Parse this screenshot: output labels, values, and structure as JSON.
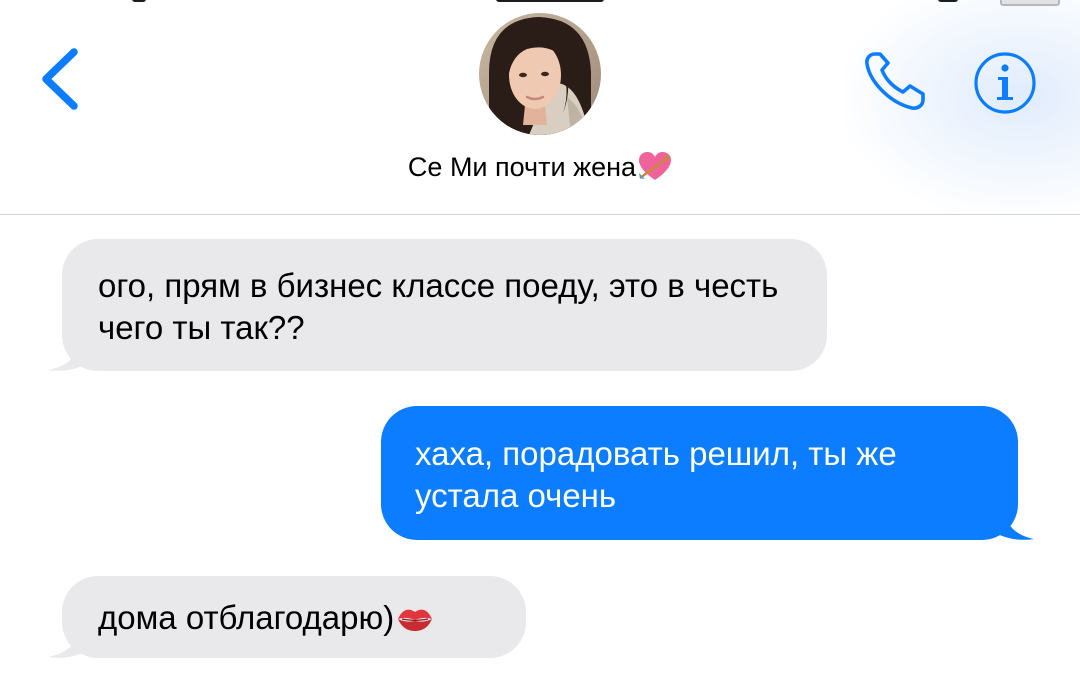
{
  "header": {
    "contact_name": "Се Ми почти жена",
    "name_emoji": "heart-with-arrow-emoji",
    "back_icon": "chevron-left-icon",
    "call_icon": "phone-icon",
    "info_icon": "info-icon",
    "avatar": "contact-photo"
  },
  "messages": [
    {
      "direction": "incoming",
      "text": "ого, прям в бизнес классе поеду, это в честь чего ты так??"
    },
    {
      "direction": "outgoing",
      "text": "хаха, порадовать решил, ты же устала очень"
    },
    {
      "direction": "incoming",
      "text": "дома отблагодарю)",
      "emoji": "kiss-mark-emoji"
    }
  ],
  "colors": {
    "accent": "#0b7dfe",
    "incoming_bubble": "#e9e9eb",
    "outgoing_bubble": "#0b7dfe",
    "divider": "#d3d3d6",
    "heart": "#f0629a",
    "kiss": "#e2363f"
  }
}
